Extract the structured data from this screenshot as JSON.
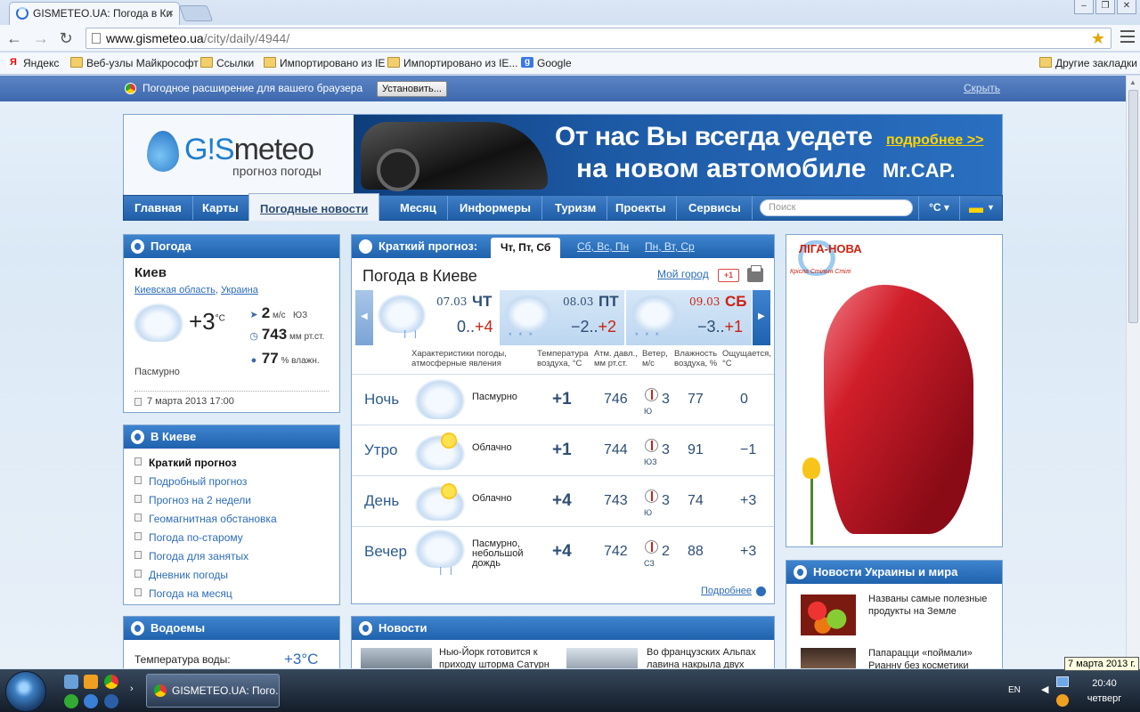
{
  "browser": {
    "tab_title": "GISMETEO.UA: Погода в Ки",
    "tab_close": "×",
    "url_host": "www.gismeteo.ua",
    "url_path": "/city/daily/4944/",
    "bookmarks": [
      "Яндекс",
      "Веб-узлы Майкрософт",
      "Ссылки",
      "Импортировано из IE",
      "Импортировано из IE...",
      "Google"
    ],
    "other_bookmarks": "Другие закладки"
  },
  "extension_bar": {
    "text": "Погодное расширение для вашего браузера",
    "install": "Установить...",
    "hide": "Скрыть"
  },
  "header": {
    "logo_prefix": "G!S",
    "logo_word": "meteo",
    "logo_sub": "прогноз погоды",
    "banner_line1": "От нас Вы всегда уедете",
    "banner_line2": "на новом автомобиле",
    "banner_more": "подробнее >>",
    "banner_brand": "Mr.CAP."
  },
  "nav": {
    "items": [
      "Главная",
      "Карты",
      "Погодные новости",
      "Месяц",
      "Информеры",
      "Туризм",
      "Проекты",
      "Сервисы"
    ],
    "search_placeholder": "Поиск",
    "unit": "°C ▾"
  },
  "current": {
    "title": "Погода",
    "city": "Киев",
    "region": "Киевская область",
    "region_sep": ", ",
    "country": "Украина",
    "temp": "+3",
    "temp_unit": "°C",
    "wind_value": "2",
    "wind_unit": "м/с",
    "wind_dir": "ЮЗ",
    "pressure_value": "743",
    "pressure_unit": "мм рт.ст.",
    "humidity_value": "77",
    "humidity_unit": "% влажн.",
    "condition": "Пасмурно",
    "updated": "7 марта 2013 17:00"
  },
  "city_menu": {
    "title": "В Киеве",
    "items": [
      "Краткий прогноз",
      "Подробный прогноз",
      "Прогноз на 2 недели",
      "Геомагнитная обстановка",
      "Погода по-старому",
      "Погода для занятых",
      "Дневник погоды",
      "Погода на месяц"
    ]
  },
  "water": {
    "title": "Водоемы",
    "label": "Температура воды:",
    "value": "+3°C"
  },
  "forecast": {
    "tab_title": "Краткий прогноз:",
    "tabs": [
      "Чт, Пт, Сб",
      "Сб, Вс, Пн",
      "Пн, Вт, Ср"
    ],
    "heading": "Погода в Киеве",
    "my_city": "Мой город",
    "gplus": "+1",
    "days": [
      {
        "date": "07.03",
        "dow": "ЧТ",
        "lo": "0..",
        "hi": "+4"
      },
      {
        "date": "08.03",
        "dow": "ПТ",
        "lo": "−2..",
        "hi": "+2"
      },
      {
        "date": "09.03",
        "dow": "СБ",
        "lo": "−3..",
        "hi": "+1"
      }
    ],
    "columns": {
      "cond": "Характеристики погоды, атмосферные явления",
      "temp": "Температура воздуха, °C",
      "press": "Атм. давл., мм рт.ст.",
      "wind": "Ветер, м/с",
      "hum": "Влажность воздуха, %",
      "feel": "Ощущается, °C"
    },
    "rows": [
      {
        "part": "Ночь",
        "cond": "Пасмурно",
        "t": "+1",
        "p": "746",
        "dir": "Ю",
        "w": "3",
        "h": "77",
        "f": "0"
      },
      {
        "part": "Утро",
        "cond": "Облачно",
        "t": "+1",
        "p": "744",
        "dir": "ЮЗ",
        "w": "3",
        "h": "91",
        "f": "−1"
      },
      {
        "part": "День",
        "cond": "Облачно",
        "t": "+4",
        "p": "743",
        "dir": "Ю",
        "w": "3",
        "h": "74",
        "f": "+3"
      },
      {
        "part": "Вечер",
        "cond": "Пасмурно, небольшой дождь",
        "t": "+4",
        "p": "742",
        "dir": "СЗ",
        "w": "2",
        "h": "88",
        "f": "+3"
      }
    ],
    "more": "Подробнее"
  },
  "news": {
    "title": "Новости",
    "items": [
      "Нью-Йорк готовится к приходу шторма Сатурн",
      "Во французских Альпах лавина накрыла двух"
    ]
  },
  "ad": {
    "logo": "ЛIГА-НОВА",
    "slogan": "Крiсла Стiльнi Стiлi"
  },
  "world_news": {
    "title": "Новости Украины и мира",
    "items": [
      "Названы самые полезные продукты на Земле",
      "Папарацци «поймали» Рианну без косметики"
    ]
  },
  "taskbar": {
    "task_title": "GISMETEO.UA: Пого...",
    "lang": "EN",
    "time": "20:40",
    "weekday": "четверг",
    "tooltip": "7 марта 2013 г."
  }
}
